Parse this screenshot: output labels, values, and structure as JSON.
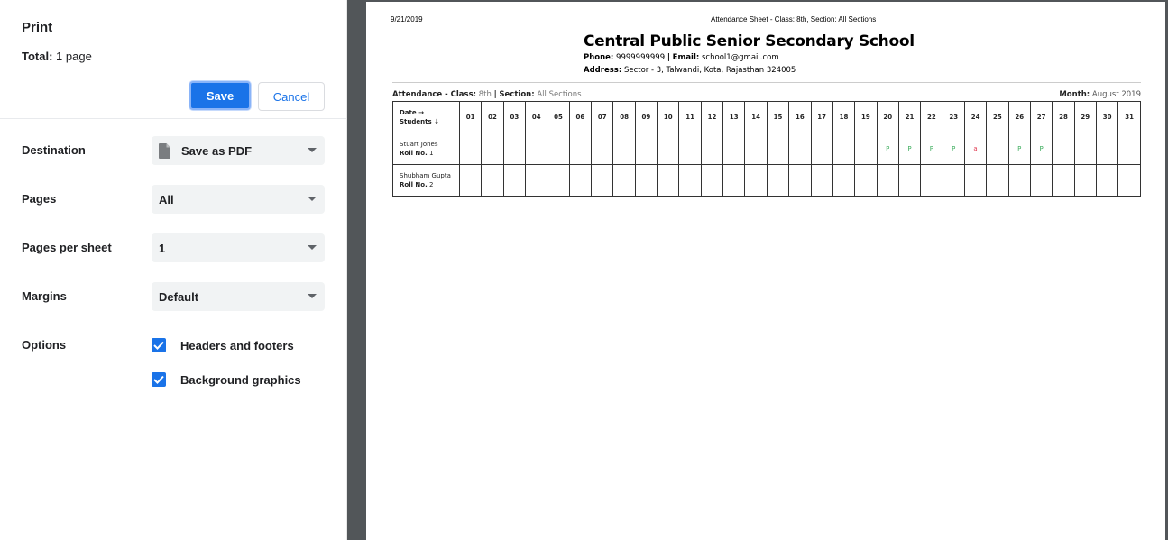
{
  "sidebar": {
    "title": "Print",
    "total_label": "Total:",
    "total_value": "1 page",
    "save_label": "Save",
    "cancel_label": "Cancel",
    "settings": [
      {
        "label": "Destination",
        "value": "Save as PDF",
        "icon": "document-icon"
      },
      {
        "label": "Pages",
        "value": "All"
      },
      {
        "label": "Pages per sheet",
        "value": "1"
      },
      {
        "label": "Margins",
        "value": "Default"
      }
    ],
    "options_label": "Options",
    "options": [
      {
        "label": "Headers and footers",
        "checked": true
      },
      {
        "label": "Background graphics",
        "checked": true
      }
    ]
  },
  "preview": {
    "header_date": "9/21/2019",
    "header_title": "Attendance Sheet - Class: 8th, Section: All Sections",
    "school_name": "Central Public Senior Secondary School",
    "phone_label": "Phone:",
    "phone": "9999999999",
    "email_label": "Email:",
    "email": "school1@gmail.com",
    "address_label": "Address:",
    "address": "Sector - 3, Talwandi, Kota, Rajasthan 324005",
    "attendance_label": "Attendance - Class:",
    "class_value": "8th",
    "section_label": "Section:",
    "section_value": "All Sections",
    "month_label": "Month:",
    "month_value": "August 2019",
    "table": {
      "corner_line1": "Date →",
      "corner_line2": "Students ↓",
      "days": [
        "01",
        "02",
        "03",
        "04",
        "05",
        "06",
        "07",
        "08",
        "09",
        "10",
        "11",
        "12",
        "13",
        "14",
        "15",
        "16",
        "17",
        "18",
        "19",
        "20",
        "21",
        "22",
        "23",
        "24",
        "25",
        "26",
        "27",
        "28",
        "29",
        "30",
        "31"
      ],
      "roll_label": "Roll No.",
      "students": [
        {
          "name": "Stuart Jones",
          "roll": "1",
          "marks": [
            "",
            "",
            "",
            "",
            "",
            "",
            "",
            "",
            "",
            "",
            "",
            "",
            "",
            "",
            "",
            "",
            "",
            "",
            "",
            "P",
            "P",
            "P",
            "P",
            "a",
            "",
            "P",
            "P",
            "",
            "",
            "",
            ""
          ]
        },
        {
          "name": "Shubham Gupta",
          "roll": "2",
          "marks": [
            "",
            "",
            "",
            "",
            "",
            "",
            "",
            "",
            "",
            "",
            "",
            "",
            "",
            "",
            "",
            "",
            "",
            "",
            "",
            "",
            "",
            "",
            "",
            "",
            "",
            "",
            "",
            "",
            "",
            "",
            ""
          ]
        }
      ]
    },
    "colors": {
      "present": "#3cad5c",
      "absent": "#e0384f",
      "accent": "#1a73e8"
    }
  }
}
